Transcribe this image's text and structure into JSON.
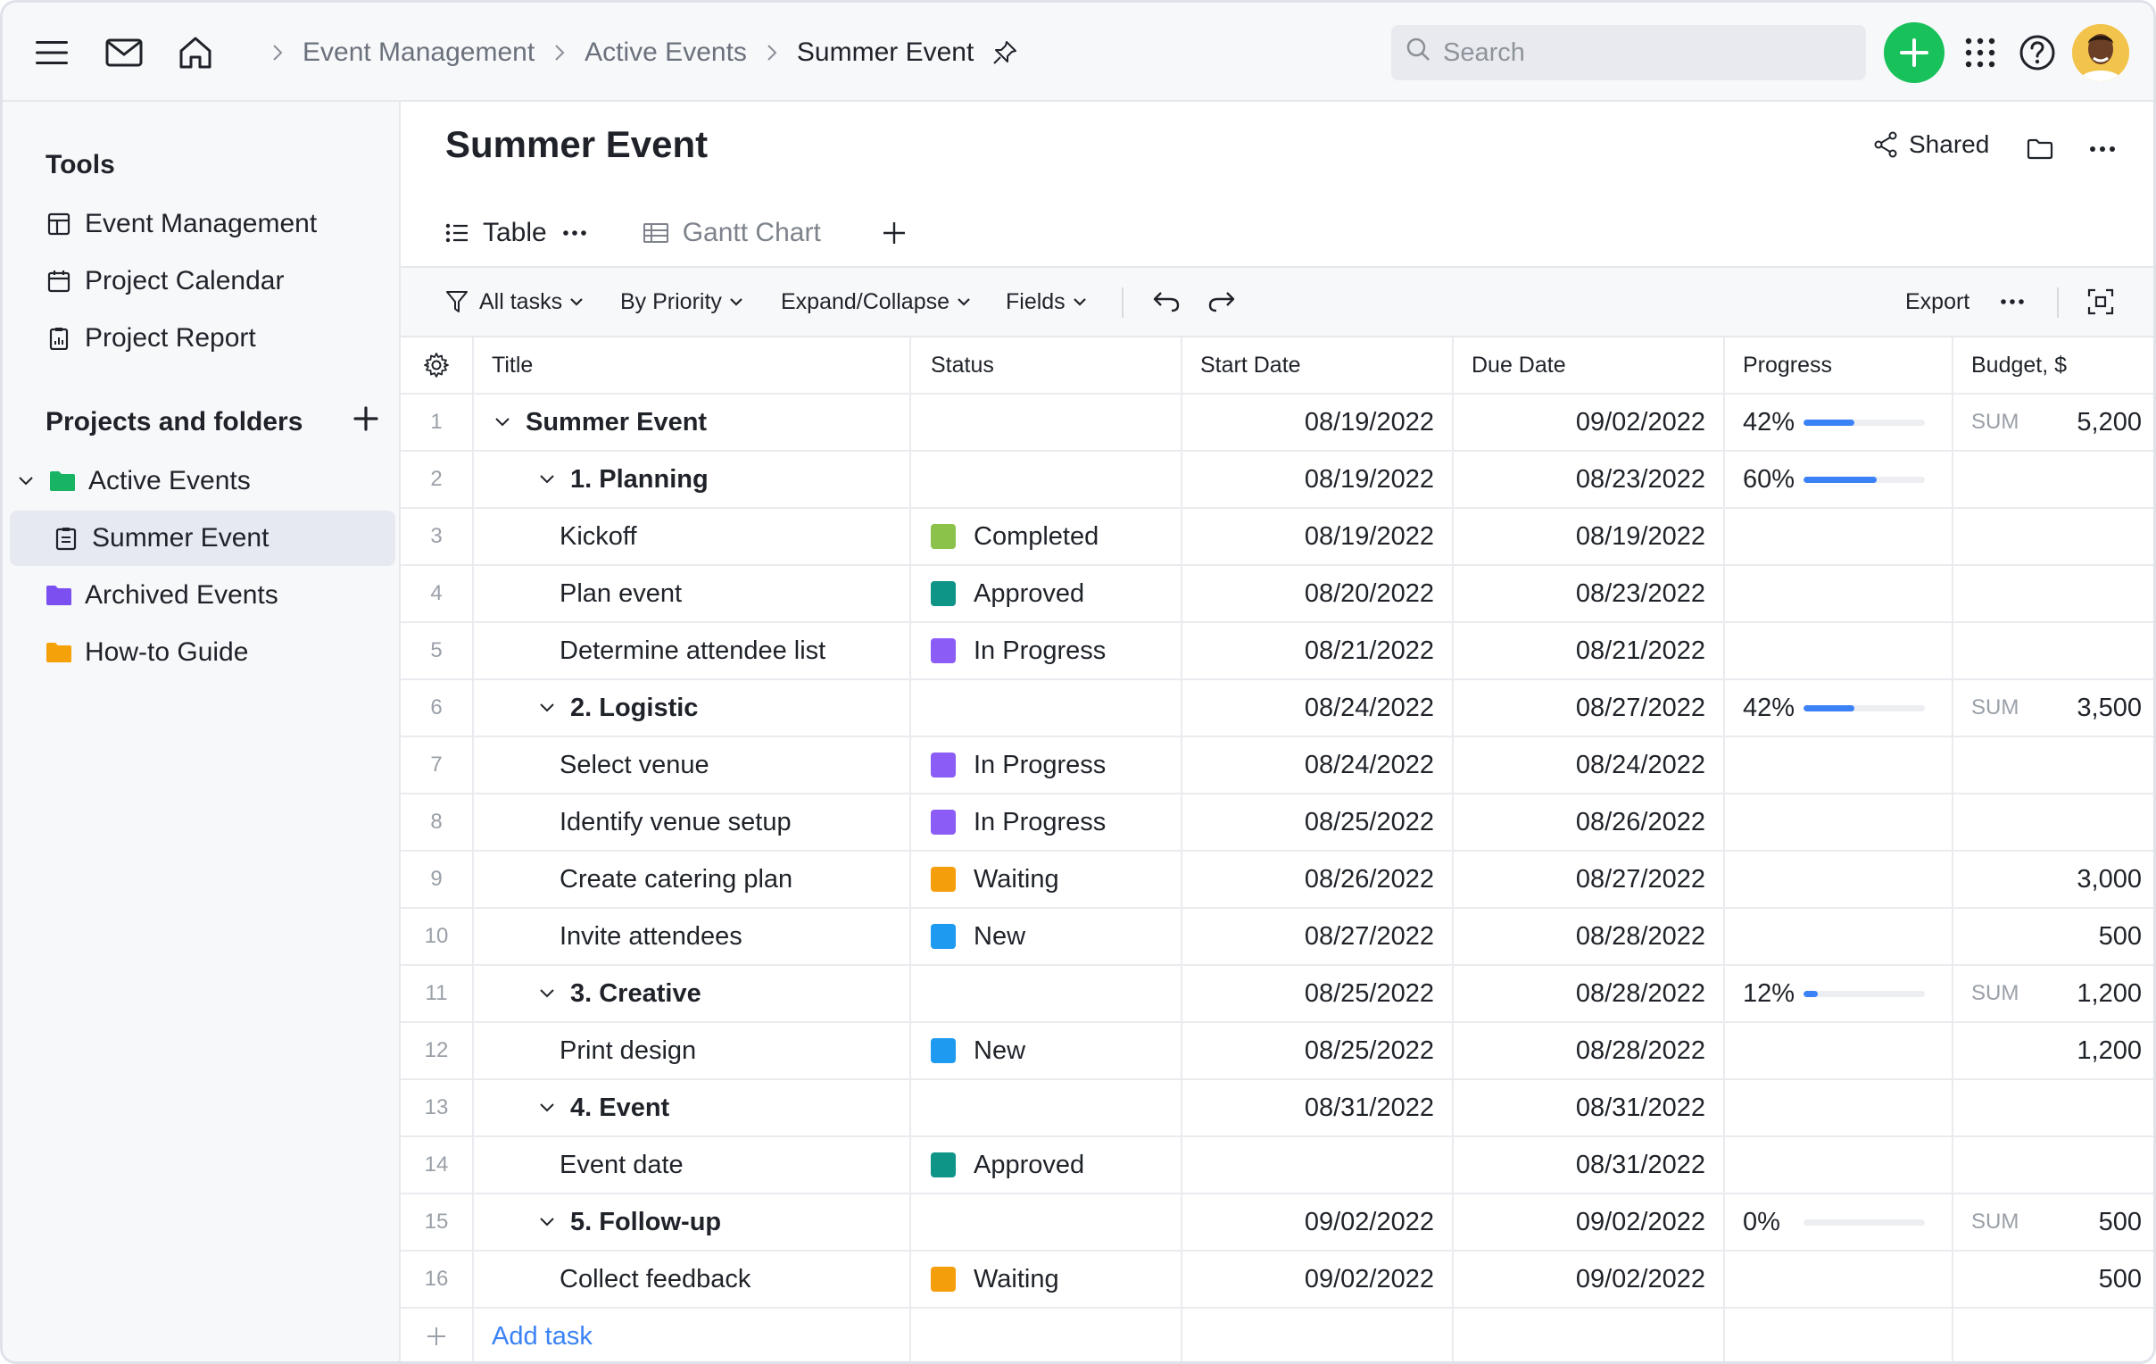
{
  "breadcrumb": {
    "items": [
      "Event Management",
      "Active Events",
      "Summer Event"
    ]
  },
  "search": {
    "placeholder": "Search"
  },
  "sidebar": {
    "tools_heading": "Tools",
    "tools": [
      {
        "label": "Event Management",
        "icon": "board-icon"
      },
      {
        "label": "Project Calendar",
        "icon": "calendar-icon"
      },
      {
        "label": "Project Report",
        "icon": "report-icon"
      }
    ],
    "projects_heading": "Projects and folders",
    "folders": [
      {
        "label": "Active Events",
        "color": "#18b463"
      },
      {
        "label": "Summer Event"
      },
      {
        "label": "Archived Events",
        "color": "#7b4ff0"
      },
      {
        "label": "How-to Guide",
        "color": "#f5a10a"
      }
    ]
  },
  "main": {
    "title": "Summer Event",
    "shared_label": "Shared",
    "tabs": [
      {
        "label": "Table",
        "active": true
      },
      {
        "label": "Gantt Chart",
        "active": false
      }
    ],
    "toolbar": {
      "all_tasks": "All tasks",
      "by_priority": "By Priority",
      "expand_collapse": "Expand/Collapse",
      "fields": "Fields",
      "export": "Export"
    }
  },
  "table": {
    "columns": [
      "Title",
      "Status",
      "Start Date",
      "Due Date",
      "Progress",
      "Budget, $"
    ],
    "sum_label": "SUM",
    "add_task_label": "Add task",
    "status_colors": {
      "Completed": "#8bc34a",
      "Approved": "#0f9488",
      "In Progress": "#8b5cf6",
      "Waiting": "#f59e0b",
      "New": "#1e9bf0"
    },
    "rows": [
      {
        "num": "1",
        "title": "Summer Event",
        "level": 0,
        "group": true,
        "status": "",
        "start": "08/19/2022",
        "due": "09/02/2022",
        "progress": "42%",
        "progress_value": 0.42,
        "sum": true,
        "budget": "5,200"
      },
      {
        "num": "2",
        "title": "1. Planning",
        "level": 1,
        "group": true,
        "status": "",
        "start": "08/19/2022",
        "due": "08/23/2022",
        "progress": "60%",
        "progress_value": 0.6,
        "sum": false,
        "budget": ""
      },
      {
        "num": "3",
        "title": "Kickoff",
        "level": 2,
        "group": false,
        "status": "Completed",
        "start": "08/19/2022",
        "due": "08/19/2022",
        "progress": "",
        "sum": false,
        "budget": ""
      },
      {
        "num": "4",
        "title": "Plan event",
        "level": 2,
        "group": false,
        "status": "Approved",
        "start": "08/20/2022",
        "due": "08/23/2022",
        "progress": "",
        "sum": false,
        "budget": ""
      },
      {
        "num": "5",
        "title": "Determine attendee list",
        "level": 2,
        "group": false,
        "status": "In Progress",
        "start": "08/21/2022",
        "due": "08/21/2022",
        "progress": "",
        "sum": false,
        "budget": ""
      },
      {
        "num": "6",
        "title": "2. Logistic",
        "level": 1,
        "group": true,
        "status": "",
        "start": "08/24/2022",
        "due": "08/27/2022",
        "progress": "42%",
        "progress_value": 0.42,
        "sum": true,
        "budget": "3,500"
      },
      {
        "num": "7",
        "title": "Select venue",
        "level": 2,
        "group": false,
        "status": "In Progress",
        "start": "08/24/2022",
        "due": "08/24/2022",
        "progress": "",
        "sum": false,
        "budget": ""
      },
      {
        "num": "8",
        "title": "Identify venue setup",
        "level": 2,
        "group": false,
        "status": "In Progress",
        "start": "08/25/2022",
        "due": "08/26/2022",
        "progress": "",
        "sum": false,
        "budget": ""
      },
      {
        "num": "9",
        "title": "Create catering plan",
        "level": 2,
        "group": false,
        "status": "Waiting",
        "start": "08/26/2022",
        "due": "08/27/2022",
        "progress": "",
        "sum": false,
        "budget": "3,000"
      },
      {
        "num": "10",
        "title": "Invite attendees",
        "level": 2,
        "group": false,
        "status": "New",
        "start": "08/27/2022",
        "due": "08/28/2022",
        "progress": "",
        "sum": false,
        "budget": "500"
      },
      {
        "num": "11",
        "title": "3. Creative",
        "level": 1,
        "group": true,
        "status": "",
        "start": "08/25/2022",
        "due": "08/28/2022",
        "progress": "12%",
        "progress_value": 0.12,
        "sum": true,
        "budget": "1,200"
      },
      {
        "num": "12",
        "title": "Print design",
        "level": 2,
        "group": false,
        "status": "New",
        "start": "08/25/2022",
        "due": "08/28/2022",
        "progress": "",
        "sum": false,
        "budget": "1,200"
      },
      {
        "num": "13",
        "title": "4. Event",
        "level": 1,
        "group": true,
        "status": "",
        "start": "08/31/2022",
        "due": "08/31/2022",
        "progress": "",
        "sum": false,
        "budget": ""
      },
      {
        "num": "14",
        "title": "Event date",
        "level": 2,
        "group": false,
        "status": "Approved",
        "start": "",
        "due": "08/31/2022",
        "progress": "",
        "sum": false,
        "budget": ""
      },
      {
        "num": "15",
        "title": "5. Follow-up",
        "level": 1,
        "group": true,
        "status": "",
        "start": "09/02/2022",
        "due": "09/02/2022",
        "progress": "0%",
        "progress_value": 0,
        "sum": true,
        "budget": "500"
      },
      {
        "num": "16",
        "title": "Collect feedback",
        "level": 2,
        "group": false,
        "status": "Waiting",
        "start": "09/02/2022",
        "due": "09/02/2022",
        "progress": "",
        "sum": false,
        "budget": "500"
      }
    ]
  },
  "colors": {
    "accent": "#3b82f6",
    "add_button": "#18c15a"
  }
}
